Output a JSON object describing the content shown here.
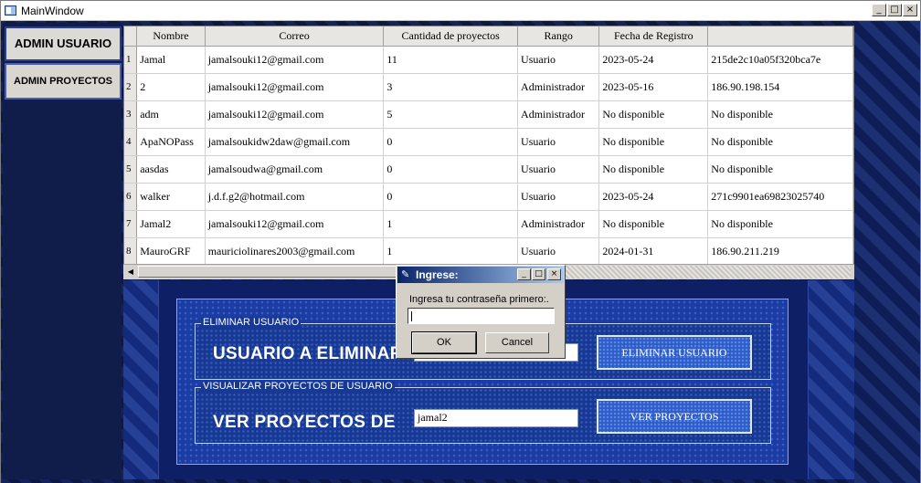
{
  "window": {
    "title": "MainWindow"
  },
  "sidebar": {
    "items": [
      {
        "label": "ADMIN USUARIO"
      },
      {
        "label": "ADMIN PROYECTOS"
      }
    ]
  },
  "table": {
    "columns": [
      "Nombre",
      "Correo",
      "Cantidad de proyectos",
      "Rango",
      "Fecha de Registro",
      ""
    ],
    "rows": [
      {
        "n": "1",
        "cells": [
          "Jamal",
          "jamalsouki12@gmail.com",
          "11",
          "Usuario",
          "2023-05-24",
          "215de2c10a05f320bca7e"
        ]
      },
      {
        "n": "2",
        "cells": [
          "2",
          "jamalsouki12@gmail.com",
          "3",
          "Administrador",
          "2023-05-16",
          "186.90.198.154"
        ]
      },
      {
        "n": "3",
        "cells": [
          "adm",
          "jamalsouki12@gmail.com",
          "5",
          "Administrador",
          "No disponible",
          "No disponible"
        ]
      },
      {
        "n": "4",
        "cells": [
          "ApaNOPass",
          "jamalsoukidw2daw@gmail.com",
          "0",
          "Usuario",
          "No disponible",
          "No disponible"
        ]
      },
      {
        "n": "5",
        "cells": [
          "aasdas",
          "jamalsoudwa@gmail.com",
          "0",
          "Usuario",
          "No disponible",
          "No disponible"
        ]
      },
      {
        "n": "6",
        "cells": [
          "walker",
          "j.d.f.g2@hotmail.com",
          "0",
          "Usuario",
          "2023-05-24",
          "271c9901ea69823025740"
        ]
      },
      {
        "n": "7",
        "cells": [
          "Jamal2",
          "jamalsouki12@gmail.com",
          "1",
          "Administrador",
          "No disponible",
          "No disponible"
        ]
      },
      {
        "n": "8",
        "cells": [
          "MauroGRF",
          "mauriciolinares2003@gmail.com",
          "1",
          "Usuario",
          "2024-01-31",
          "186.90.211.219"
        ]
      }
    ]
  },
  "delete_group": {
    "title": "ELIMINAR USUARIO",
    "label": "USUARIO A ELIMINAR",
    "input_value": "",
    "button": "ELIMINAR USUARIO"
  },
  "view_group": {
    "title": "VISUALIZAR PROYECTOS DE USUARIO",
    "label": "VER PROYECTOS DE",
    "input_value": "jamal2",
    "button": "VER PROYECTOS"
  },
  "dialog": {
    "title": "Ingrese:",
    "prompt": "Ingresa tu contraseña primero:.",
    "input_value": "",
    "ok": "OK",
    "cancel": "Cancel"
  }
}
